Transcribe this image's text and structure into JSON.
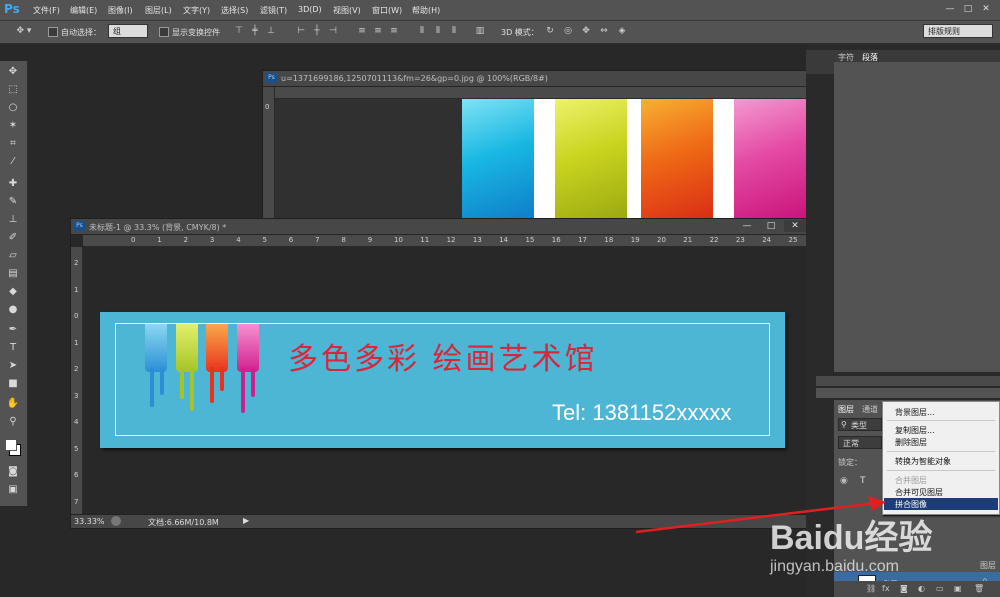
{
  "app": {
    "logo": "Ps"
  },
  "menubar": {
    "items": [
      "文件(F)",
      "编辑(E)",
      "图像(I)",
      "图层(L)",
      "文字(Y)",
      "选择(S)",
      "滤镜(T)",
      "3D(D)",
      "视图(V)",
      "窗口(W)",
      "帮助(H)"
    ],
    "window_controls": [
      "—",
      "□",
      "✕"
    ]
  },
  "options": {
    "auto_select_label": "自动选择：",
    "auto_select_value": "组",
    "show_transform_label": "显示变换控件",
    "mode3d_label": "3D 模式：",
    "workspace_value": "排版规则"
  },
  "doc_back": {
    "title": "u=1371699186,1250701113&fm=26&gp=0.jpg @ 100%(RGB/8#)",
    "ruler_numbers": [
      "0"
    ]
  },
  "doc_front": {
    "title": "未标题-1 @ 33.3% (背景, CMYK/8) *",
    "ruler_h": [
      "0",
      "1",
      "2",
      "3",
      "4",
      "5",
      "6",
      "7",
      "8",
      "9",
      "10",
      "11",
      "12",
      "13",
      "14",
      "15",
      "16",
      "17",
      "18",
      "19",
      "20",
      "21",
      "22",
      "23",
      "24",
      "25"
    ],
    "ruler_v": [
      "2",
      "1",
      "0",
      "1",
      "2",
      "3",
      "4",
      "5",
      "6",
      "7"
    ],
    "status_zoom": "33.33%",
    "status_doc": "文档:6.66M/10.8M",
    "banner_title": "多色多彩 绘画艺术馆",
    "banner_tel": "Tel: 1381152xxxxx",
    "colors": {
      "banner": "#4cb6d4",
      "title": "#d9263a",
      "drips": [
        "#2b8fd6",
        "#a5c42a",
        "#e8321f",
        "#d21f8f"
      ]
    }
  },
  "panels": {
    "top_tabs": [
      "字符",
      "段落"
    ],
    "layers_tabs": [
      "图层",
      "通道"
    ],
    "filter_label": "类型",
    "blend_mode": "正常",
    "lock_label": "锁定：",
    "layer_label_partial": "图层",
    "bg_layer_name": "背景"
  },
  "context_menu": {
    "items": [
      "背景图层...",
      "复制图层...",
      "删除图层",
      "转换为智能对象",
      "合并图层",
      "合并可见图层",
      "拼合图像"
    ],
    "highlighted": "拼合图像",
    "disabled": [
      "合并图层"
    ]
  },
  "watermark": {
    "brand": "Baidu经验",
    "url": "jingyan.baidu.com"
  }
}
